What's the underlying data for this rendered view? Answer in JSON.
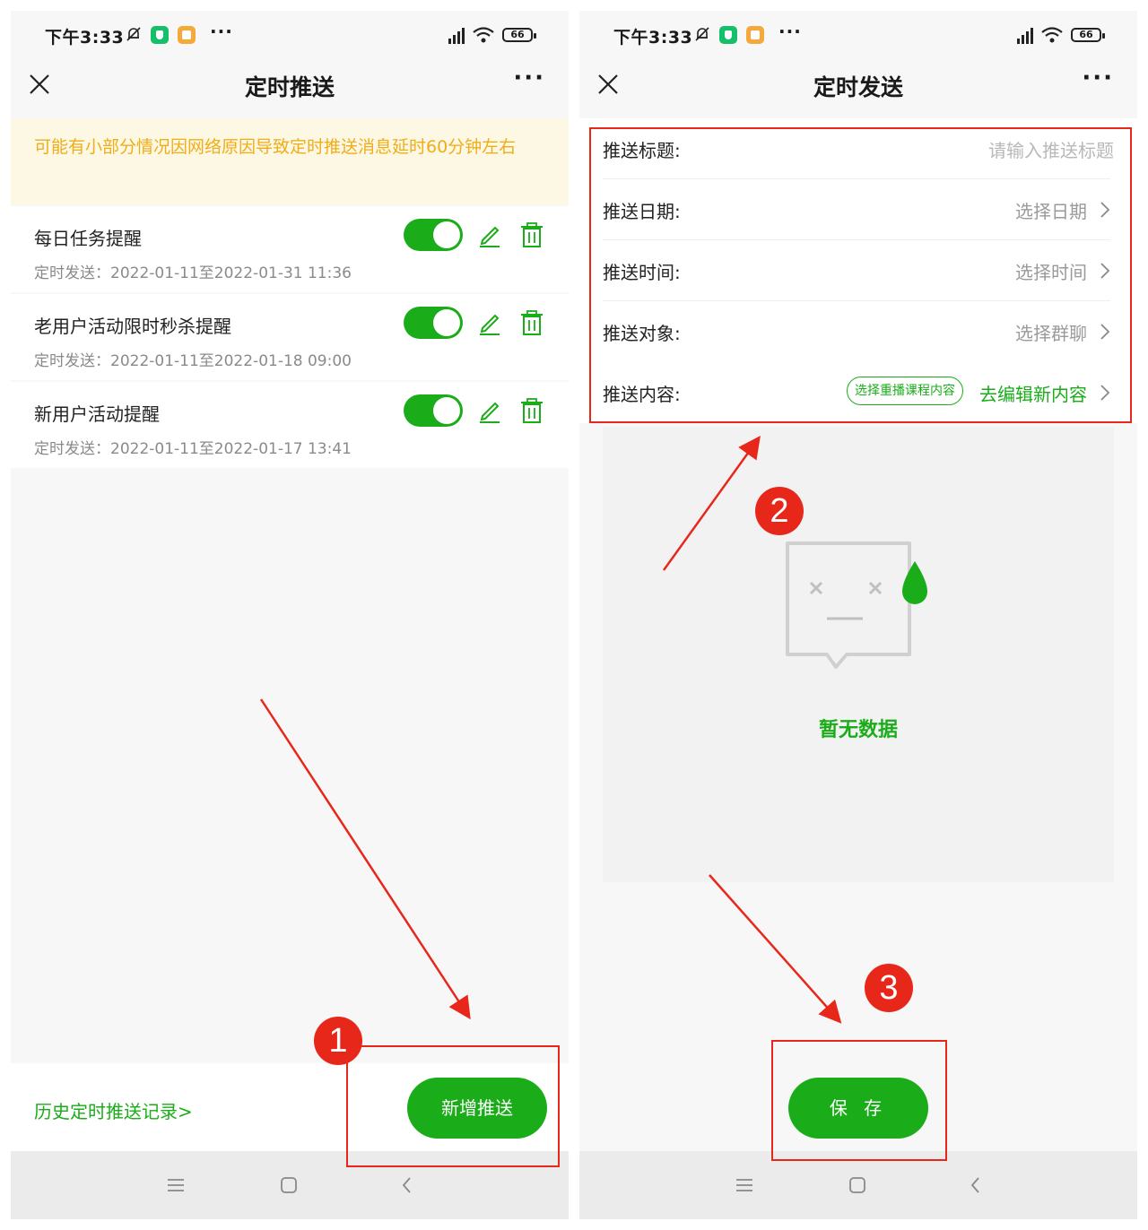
{
  "status_bar": {
    "time": "下午3:33",
    "more": "···",
    "battery": "66"
  },
  "left": {
    "title": "定时推送",
    "notice": "可能有小部分情况因网络原因导致定时推送消息延时60分钟左右",
    "tasks": [
      {
        "name": "每日任务提醒",
        "schedule": "定时发送：2022-01-11至2022-01-31 11:36",
        "enabled": true
      },
      {
        "name": "老用户活动限时秒杀提醒",
        "schedule": "定时发送：2022-01-11至2022-01-18 09:00",
        "enabled": true
      },
      {
        "name": "新用户活动提醒",
        "schedule": "定时发送：2022-01-11至2022-01-17 13:41",
        "enabled": true
      }
    ],
    "history_link": "历史定时推送记录>",
    "add_button": "新增推送"
  },
  "right": {
    "title": "定时发送",
    "form": {
      "title_label": "推送标题:",
      "title_placeholder": "请输入推送标题",
      "date_label": "推送日期:",
      "date_value": "选择日期",
      "time_label": "推送时间:",
      "time_value": "选择时间",
      "target_label": "推送对象:",
      "target_value": "选择群聊",
      "content_label": "推送内容:",
      "content_chip": "选择重播课程内容",
      "content_link": "去编辑新内容"
    },
    "empty_text": "暂无数据",
    "save_button": "保 存"
  },
  "annotations": {
    "step1": "1",
    "step2": "2",
    "step3": "3"
  },
  "colors": {
    "accent_green": "#1aad19",
    "notice_text": "#f0ad1a",
    "notice_bg": "#fdf8e4",
    "annotation_red": "#e8271b"
  },
  "icons": [
    "mute-bell-icon",
    "close-icon",
    "more-icon",
    "edit-pencil-icon",
    "trash-icon",
    "chevron-right-icon",
    "menu-icon",
    "home-icon",
    "back-icon",
    "signal-icon",
    "wifi-icon",
    "battery-icon"
  ]
}
